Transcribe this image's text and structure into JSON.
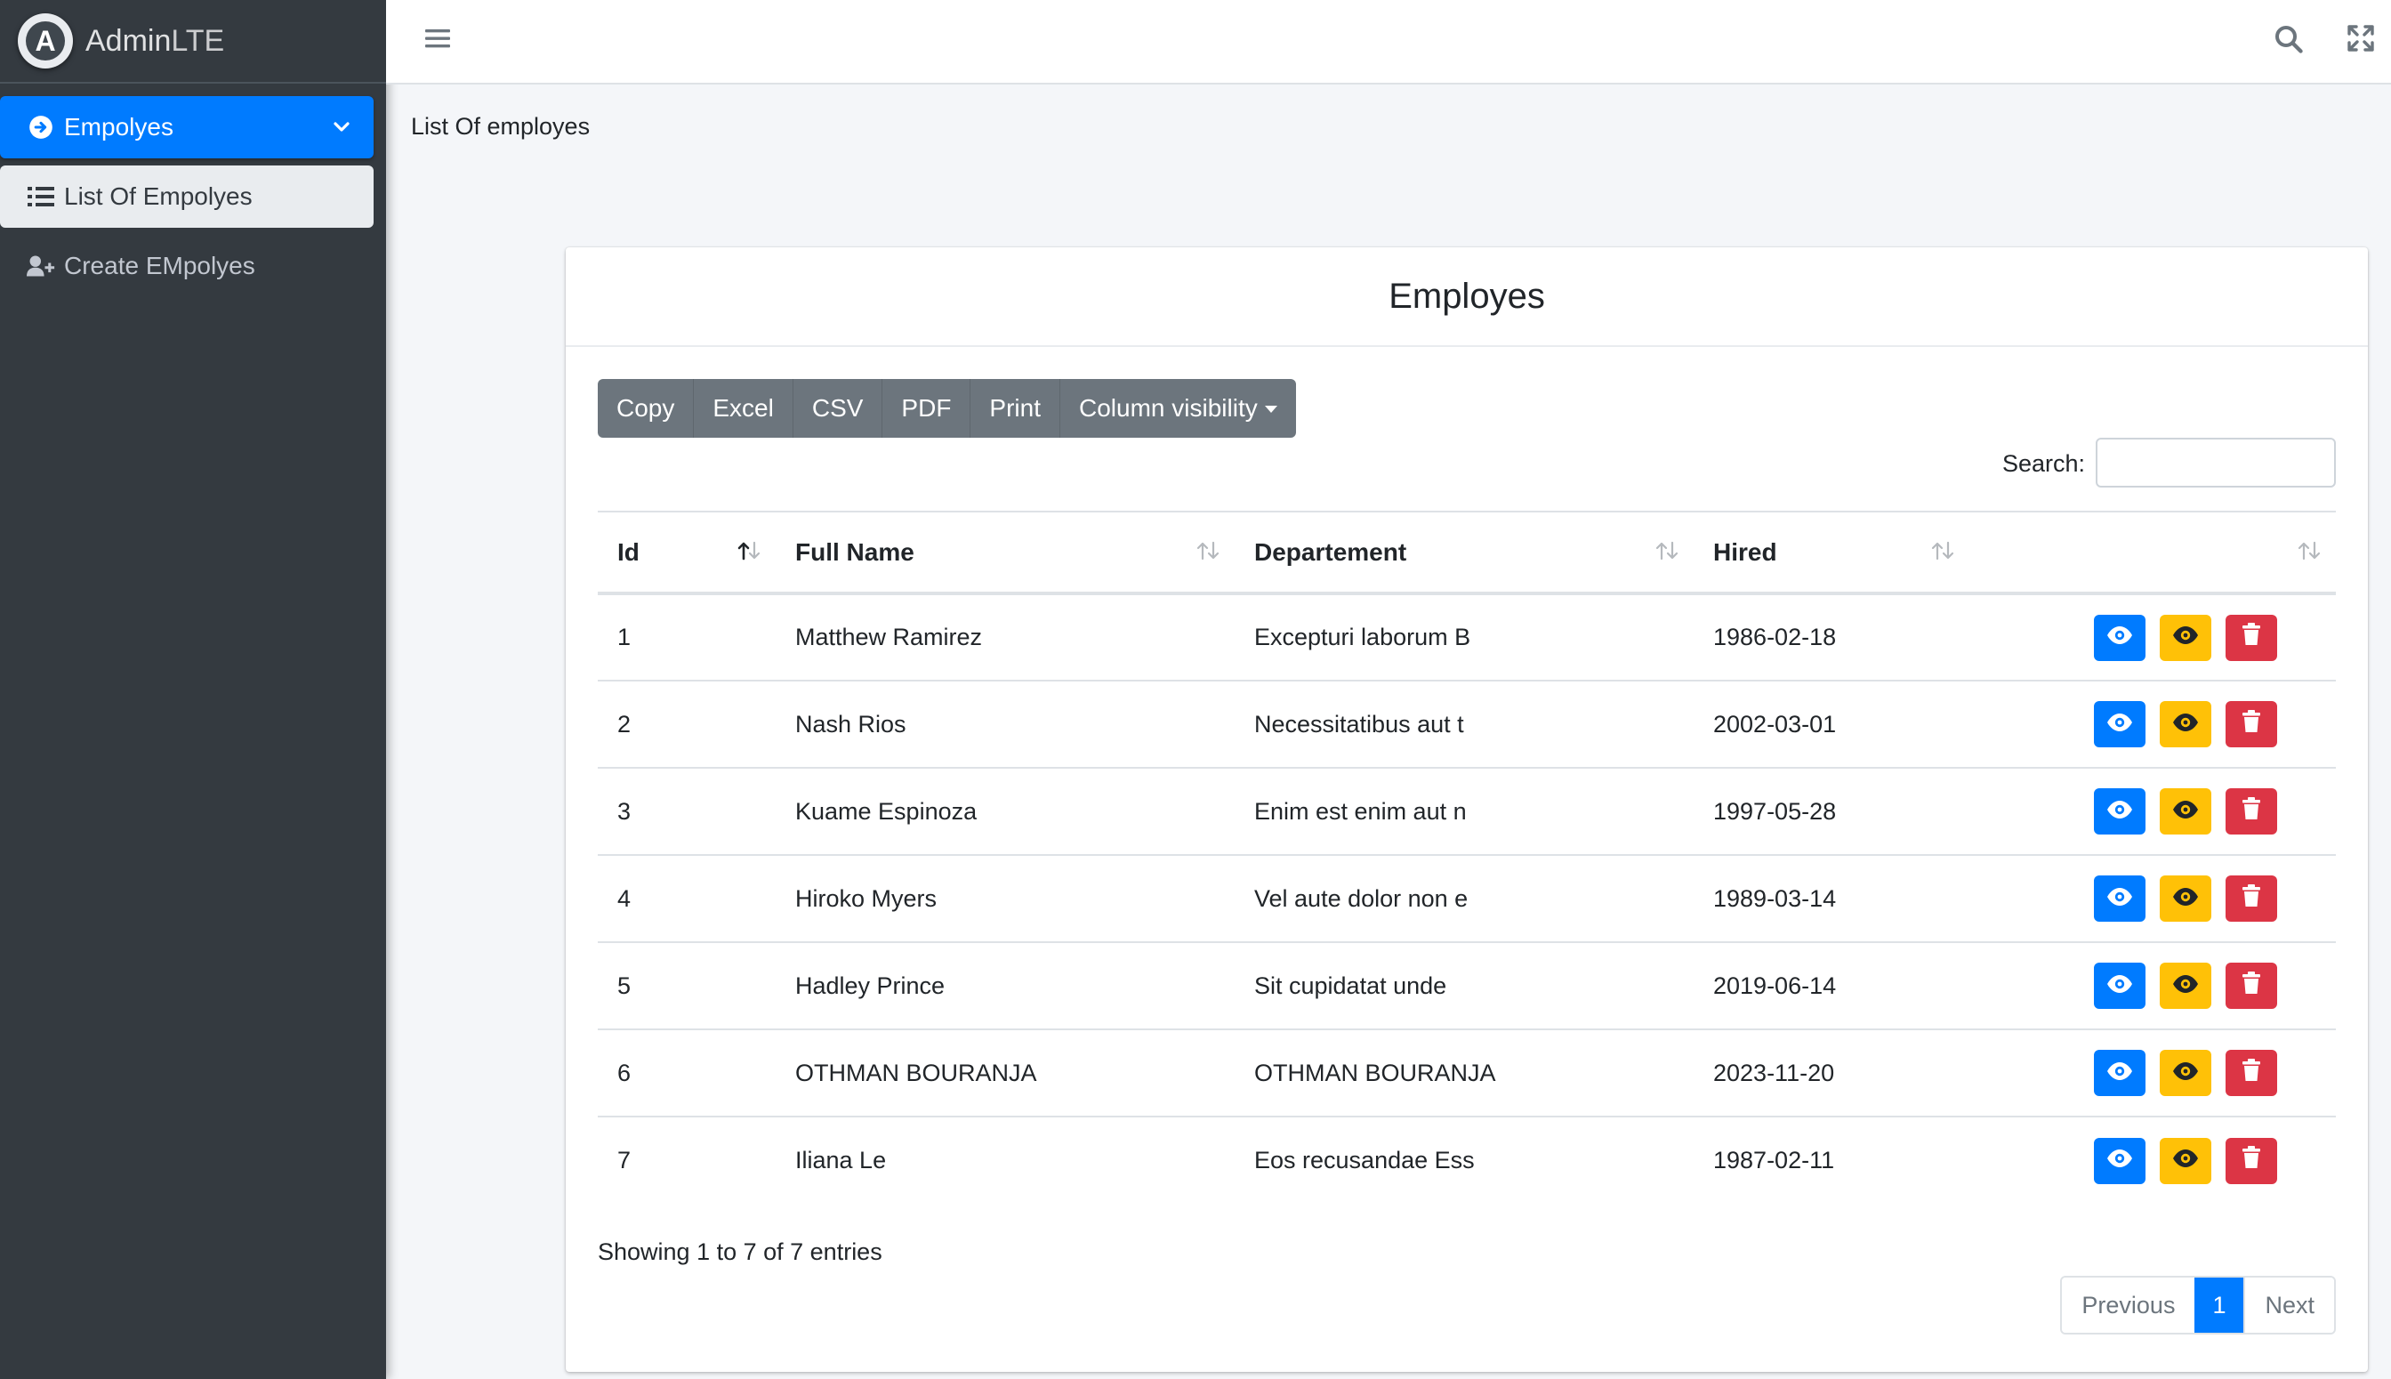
{
  "brand": {
    "name_bold": "Admin",
    "name_light": "LTE",
    "logo_letter": "A"
  },
  "sidebar": {
    "items": [
      {
        "label": "Empolyes",
        "icon": "arrow-circle-right-icon"
      },
      {
        "label": "List Of Empolyes",
        "icon": "list-icon"
      },
      {
        "label": "Create EMpolyes",
        "icon": "user-plus-icon"
      }
    ]
  },
  "page": {
    "heading": "List Of employes"
  },
  "card": {
    "title": "Employes"
  },
  "toolbar": {
    "copy": "Copy",
    "excel": "Excel",
    "csv": "CSV",
    "pdf": "PDF",
    "print": "Print",
    "colvis": "Column visibility"
  },
  "search": {
    "label": "Search:",
    "value": "",
    "placeholder": ""
  },
  "table": {
    "columns": [
      "Id",
      "Full Name",
      "Departement",
      "Hired",
      ""
    ],
    "rows": [
      {
        "id": "1",
        "name": "Matthew Ramirez",
        "dept": "Excepturi laborum B",
        "hired": "1986-02-18"
      },
      {
        "id": "2",
        "name": "Nash Rios",
        "dept": "Necessitatibus aut t",
        "hired": "2002-03-01"
      },
      {
        "id": "3",
        "name": "Kuame Espinoza",
        "dept": "Enim est enim aut n",
        "hired": "1997-05-28"
      },
      {
        "id": "4",
        "name": "Hiroko Myers",
        "dept": "Vel aute dolor non e",
        "hired": "1989-03-14"
      },
      {
        "id": "5",
        "name": "Hadley Prince",
        "dept": "Sit cupidatat unde",
        "hired": "2019-06-14"
      },
      {
        "id": "6",
        "name": "OTHMAN BOURANJA",
        "dept": "OTHMAN BOURANJA",
        "hired": "2023-11-20"
      },
      {
        "id": "7",
        "name": "Iliana Le",
        "dept": "Eos recusandae Ess",
        "hired": "1987-02-11"
      }
    ],
    "row_actions": [
      "view-icon",
      "edit-eye-icon",
      "trash-icon"
    ]
  },
  "footer": {
    "info": "Showing 1 to 7 of 7 entries"
  },
  "pagination": {
    "previous": "Previous",
    "current": "1",
    "next": "Next"
  },
  "colors": {
    "primary": "#007bff",
    "warning": "#ffc107",
    "danger": "#dc3545",
    "sidebar": "#343a40"
  }
}
